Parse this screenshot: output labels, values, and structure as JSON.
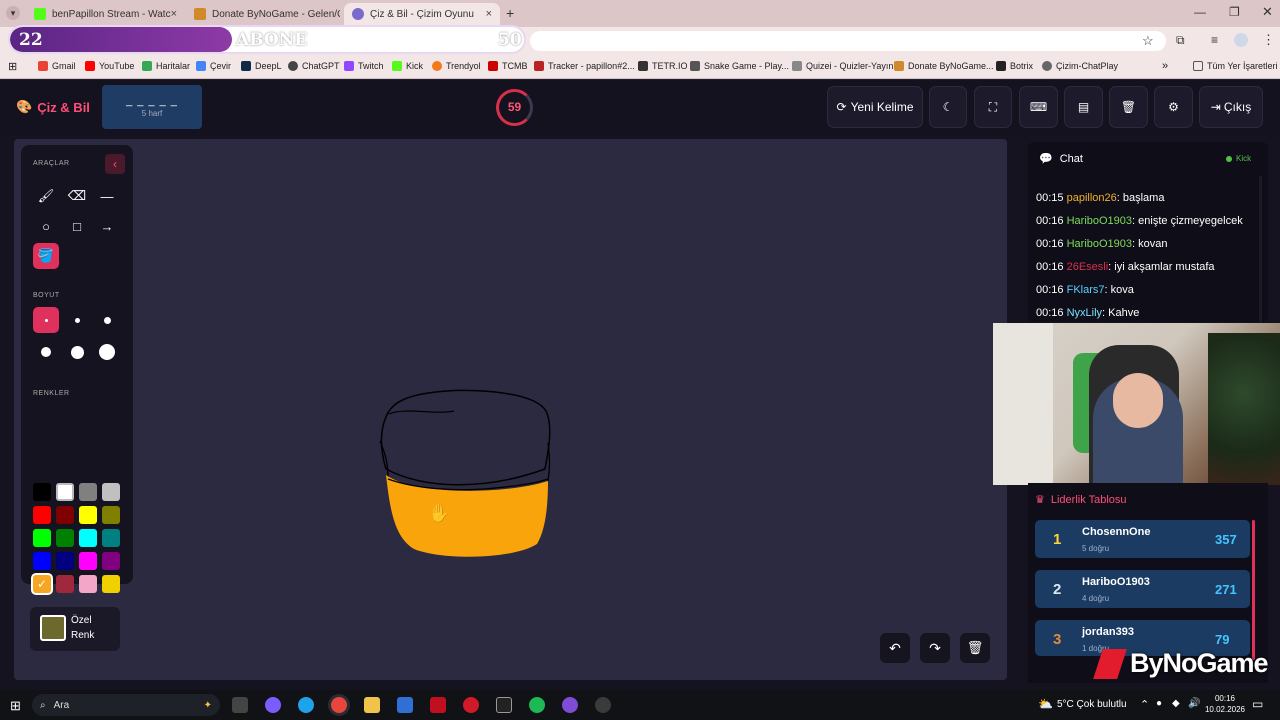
{
  "tabs": [
    {
      "label": "benPapillon Stream - Watc"
    },
    {
      "label": "Donate ByNoGame - Gelen/Gid"
    },
    {
      "label": "Çiz & Bil - Çizim Oyunu"
    }
  ],
  "overlay": {
    "left": "22",
    "mid": "ABONE",
    "right": "50"
  },
  "bookmarks": [
    "Gmail",
    "YouTube",
    "Haritalar",
    "Çevir",
    "DeepL",
    "ChatGPT",
    "Twitch",
    "Kick",
    "Trendyol",
    "TCMB",
    "Tracker - papillon#2...",
    "TETR.IO",
    "Snake Game - Play...",
    "Quizei - Quizler-Yayın",
    "Donate ByNoGame...",
    "Botrix",
    "Çizim-ChatPlay",
    "Tüm Yer İşaretleri"
  ],
  "header": {
    "logo": "Çiz & Bil",
    "word_mask": "_ _ _ _ _",
    "word_hint": "5 harf",
    "timer": "59",
    "new_word": "Yeni Kelime",
    "exit": "Çıkış"
  },
  "tools": {
    "title": "ARAÇLAR",
    "size_title": "BOYUT",
    "colors_title": "RENKLER",
    "custom_color": "Özel Renk",
    "colors": [
      "#000000",
      "#ffffff",
      "#808080",
      "#c0c0c0",
      "#ff0000",
      "#800000",
      "#ffff00",
      "#808000",
      "#00ff00",
      "#008000",
      "#00ffff",
      "#008080",
      "#0000ff",
      "#000080",
      "#ff00ff",
      "#800080",
      "#f5a623",
      "#a0283c",
      "#f4a6c8",
      "#f0d000"
    ]
  },
  "chat": {
    "title": "Chat",
    "platform": "Kick",
    "messages": [
      {
        "time": "00:15",
        "user": "papillon26",
        "text": "başlama",
        "color": "#f0b030"
      },
      {
        "time": "00:16",
        "user": "HariboO1903",
        "text": "enişte çizmeyegelcek",
        "color": "#7ddc5b"
      },
      {
        "time": "00:16",
        "user": "HariboO1903",
        "text": "kovan",
        "color": "#7ddc5b"
      },
      {
        "time": "00:16",
        "user": "26Esesli",
        "text": "iyi akşamlar mustafa",
        "color": "#d8304c"
      },
      {
        "time": "00:16",
        "user": "FKlars7",
        "text": "kova",
        "color": "#5ad0ff"
      },
      {
        "time": "00:16",
        "user": "NyxLily",
        "text": "Kahve",
        "color": "#7de0ff"
      }
    ]
  },
  "leader": {
    "title": "Liderlik Tablosu",
    "rows": [
      {
        "rank": "1",
        "name": "ChosennOne",
        "sub": "5 doğru",
        "score": "357"
      },
      {
        "rank": "2",
        "name": "HariboO1903",
        "sub": "4 doğru",
        "score": "271"
      },
      {
        "rank": "3",
        "name": "jordan393",
        "sub": "1 doğru",
        "score": "79"
      }
    ]
  },
  "brand": "ByNoGame",
  "taskbar": {
    "search": "Ara",
    "weather": "5°C  Çok bulutlu",
    "time": "00:16",
    "date": "10.02.2026"
  }
}
